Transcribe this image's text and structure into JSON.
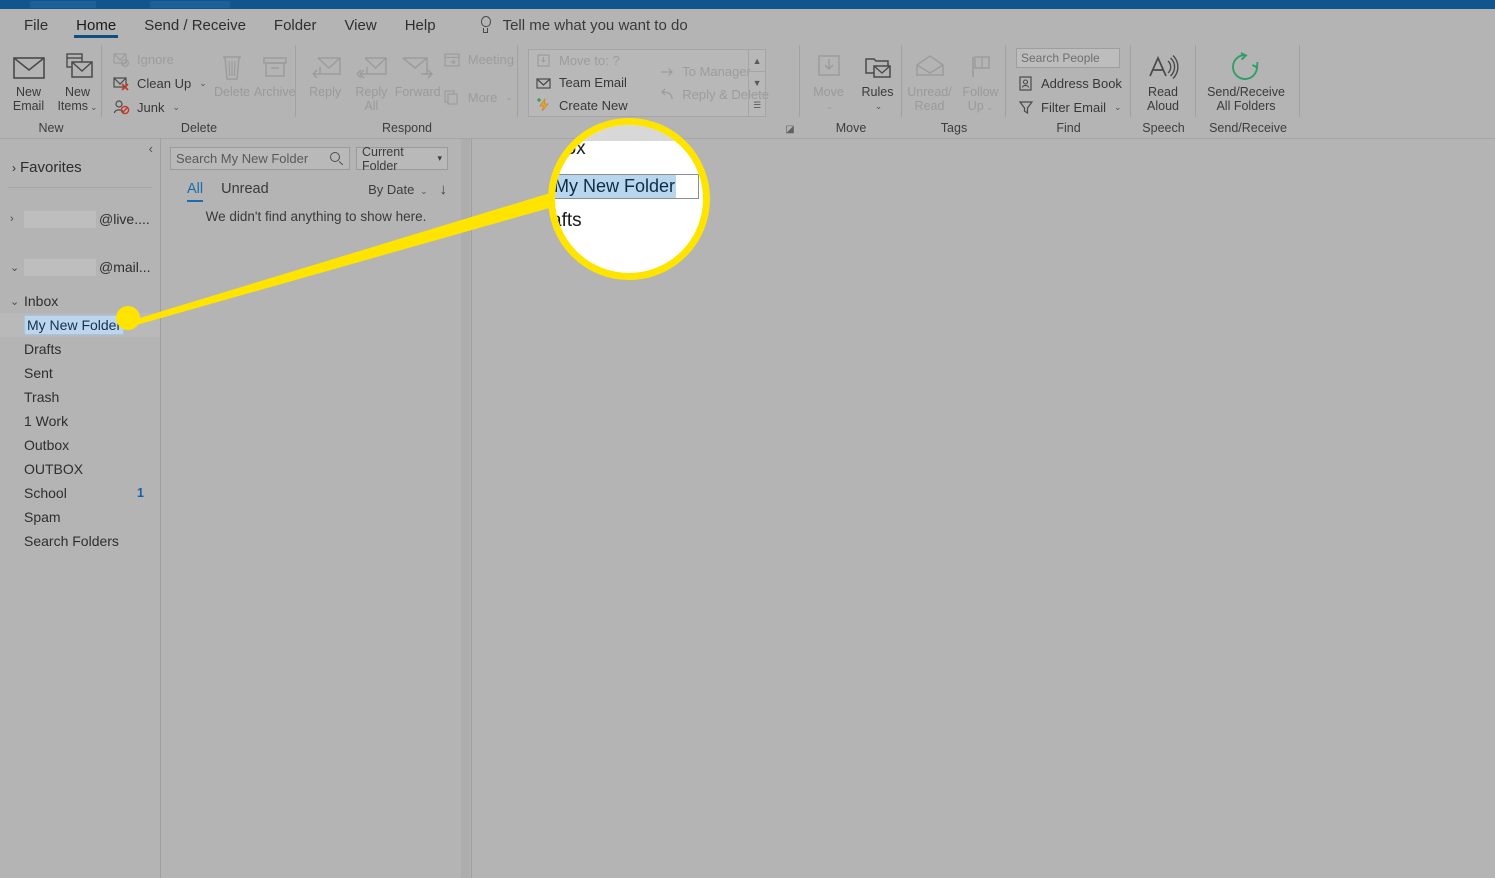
{
  "window": {
    "title_bar_color": "#10558c"
  },
  "ribbon": {
    "tabs": [
      {
        "label": "File",
        "active": false
      },
      {
        "label": "Home",
        "active": true
      },
      {
        "label": "Send / Receive",
        "active": false
      },
      {
        "label": "Folder",
        "active": false
      },
      {
        "label": "View",
        "active": false
      },
      {
        "label": "Help",
        "active": false
      }
    ],
    "tell_me": {
      "placeholder": "Tell me what you want to do",
      "icon": "lightbulb-icon"
    },
    "groups": {
      "new": {
        "label": "New",
        "new_email": "New\nEmail",
        "new_email_l1": "New",
        "new_email_l2": "Email",
        "new_items_l1": "New",
        "new_items_l2": "Items"
      },
      "delete": {
        "label": "Delete",
        "ignore": "Ignore",
        "clean_up": "Clean Up",
        "junk": "Junk",
        "delete": "Delete",
        "archive": "Archive"
      },
      "respond": {
        "label": "Respond",
        "reply": "Reply",
        "reply_all_l1": "Reply",
        "reply_all_l2": "All",
        "forward": "Forward",
        "meeting": "Meeting",
        "more": "More"
      },
      "quick_steps": {
        "label": "",
        "move_to": "Move to: ?",
        "team_email": "Team Email",
        "create_new": "Create New",
        "to_manager": "To Manager",
        "reply_delete": "Reply & Delete",
        "scroll_up": "▲",
        "scroll_down": "▼",
        "more_menu": "☰"
      },
      "move": {
        "label": "Move",
        "move": "Move",
        "rules": "Rules"
      },
      "tags": {
        "label": "Tags",
        "unread_l1": "Unread/",
        "unread_l2": "Read",
        "follow_l1": "Follow",
        "follow_l2": "Up"
      },
      "find": {
        "label": "Find",
        "search_people_placeholder": "Search People",
        "address_book": "Address Book",
        "filter_email": "Filter Email"
      },
      "speech": {
        "label": "Speech",
        "read_aloud_l1": "Read",
        "read_aloud_l2": "Aloud"
      },
      "send_receive": {
        "label": "Send/Receive",
        "l1": "Send/Receive",
        "l2": "All Folders"
      }
    }
  },
  "sidebar": {
    "collapse_icon": "‹",
    "favorites": {
      "label": "Favorites",
      "twisty": "›"
    },
    "accounts": [
      {
        "twisty": "›",
        "redacted_width": 72,
        "suffix": "@live....",
        "expanded": false
      },
      {
        "twisty": "⌄",
        "redacted_width": 72,
        "suffix": "@mail...",
        "expanded": true
      }
    ],
    "folders": [
      {
        "label": "Inbox",
        "twisty": "⌄",
        "indent": 1,
        "selected": false,
        "count": ""
      },
      {
        "label": "My New Folder",
        "twisty": "",
        "indent": 2,
        "selected": true,
        "count": ""
      },
      {
        "label": "Drafts",
        "twisty": "",
        "indent": 2,
        "selected": false,
        "count": ""
      },
      {
        "label": "Sent",
        "twisty": "",
        "indent": 2,
        "selected": false,
        "count": ""
      },
      {
        "label": "Trash",
        "twisty": "",
        "indent": 2,
        "selected": false,
        "count": ""
      },
      {
        "label": "1 Work",
        "twisty": "",
        "indent": 2,
        "selected": false,
        "count": ""
      },
      {
        "label": "Outbox",
        "twisty": "",
        "indent": 2,
        "selected": false,
        "count": ""
      },
      {
        "label": "OUTBOX",
        "twisty": "",
        "indent": 2,
        "selected": false,
        "count": ""
      },
      {
        "label": "School",
        "twisty": "",
        "indent": 2,
        "selected": false,
        "count": "1"
      },
      {
        "label": "Spam",
        "twisty": "",
        "indent": 2,
        "selected": false,
        "count": ""
      },
      {
        "label": "Search Folders",
        "twisty": "",
        "indent": 2,
        "selected": false,
        "count": ""
      }
    ]
  },
  "message_list": {
    "search_placeholder": "Search My New Folder",
    "scope_label": "Current Folder",
    "scope_caret": "▾",
    "tabs": [
      {
        "label": "All",
        "active": true
      },
      {
        "label": "Unread",
        "active": false
      }
    ],
    "sort_label": "By Date",
    "sort_caret": "⌄",
    "sort_direction_icon": "↓",
    "empty_text": "We didn't find anything to show here."
  },
  "callout": {
    "ring_color": "#ffe400",
    "magnified": {
      "above": "box",
      "input_value": "My New Folder",
      "below": "afts"
    },
    "pointer_dot_color": "#ffe400"
  }
}
